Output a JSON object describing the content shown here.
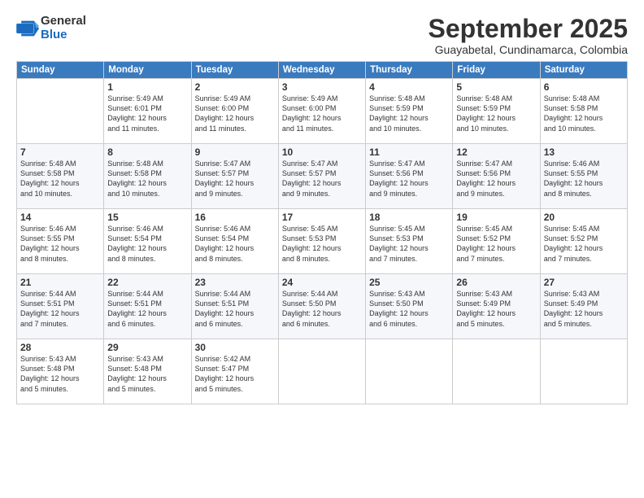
{
  "logo": {
    "general": "General",
    "blue": "Blue"
  },
  "title": "September 2025",
  "location": "Guayabetal, Cundinamarca, Colombia",
  "days_of_week": [
    "Sunday",
    "Monday",
    "Tuesday",
    "Wednesday",
    "Thursday",
    "Friday",
    "Saturday"
  ],
  "weeks": [
    [
      {
        "day": "",
        "info": ""
      },
      {
        "day": "1",
        "info": "Sunrise: 5:49 AM\nSunset: 6:01 PM\nDaylight: 12 hours\nand 11 minutes."
      },
      {
        "day": "2",
        "info": "Sunrise: 5:49 AM\nSunset: 6:00 PM\nDaylight: 12 hours\nand 11 minutes."
      },
      {
        "day": "3",
        "info": "Sunrise: 5:49 AM\nSunset: 6:00 PM\nDaylight: 12 hours\nand 11 minutes."
      },
      {
        "day": "4",
        "info": "Sunrise: 5:48 AM\nSunset: 5:59 PM\nDaylight: 12 hours\nand 10 minutes."
      },
      {
        "day": "5",
        "info": "Sunrise: 5:48 AM\nSunset: 5:59 PM\nDaylight: 12 hours\nand 10 minutes."
      },
      {
        "day": "6",
        "info": "Sunrise: 5:48 AM\nSunset: 5:58 PM\nDaylight: 12 hours\nand 10 minutes."
      }
    ],
    [
      {
        "day": "7",
        "info": "Sunrise: 5:48 AM\nSunset: 5:58 PM\nDaylight: 12 hours\nand 10 minutes."
      },
      {
        "day": "8",
        "info": "Sunrise: 5:48 AM\nSunset: 5:58 PM\nDaylight: 12 hours\nand 10 minutes."
      },
      {
        "day": "9",
        "info": "Sunrise: 5:47 AM\nSunset: 5:57 PM\nDaylight: 12 hours\nand 9 minutes."
      },
      {
        "day": "10",
        "info": "Sunrise: 5:47 AM\nSunset: 5:57 PM\nDaylight: 12 hours\nand 9 minutes."
      },
      {
        "day": "11",
        "info": "Sunrise: 5:47 AM\nSunset: 5:56 PM\nDaylight: 12 hours\nand 9 minutes."
      },
      {
        "day": "12",
        "info": "Sunrise: 5:47 AM\nSunset: 5:56 PM\nDaylight: 12 hours\nand 9 minutes."
      },
      {
        "day": "13",
        "info": "Sunrise: 5:46 AM\nSunset: 5:55 PM\nDaylight: 12 hours\nand 8 minutes."
      }
    ],
    [
      {
        "day": "14",
        "info": "Sunrise: 5:46 AM\nSunset: 5:55 PM\nDaylight: 12 hours\nand 8 minutes."
      },
      {
        "day": "15",
        "info": "Sunrise: 5:46 AM\nSunset: 5:54 PM\nDaylight: 12 hours\nand 8 minutes."
      },
      {
        "day": "16",
        "info": "Sunrise: 5:46 AM\nSunset: 5:54 PM\nDaylight: 12 hours\nand 8 minutes."
      },
      {
        "day": "17",
        "info": "Sunrise: 5:45 AM\nSunset: 5:53 PM\nDaylight: 12 hours\nand 8 minutes."
      },
      {
        "day": "18",
        "info": "Sunrise: 5:45 AM\nSunset: 5:53 PM\nDaylight: 12 hours\nand 7 minutes."
      },
      {
        "day": "19",
        "info": "Sunrise: 5:45 AM\nSunset: 5:52 PM\nDaylight: 12 hours\nand 7 minutes."
      },
      {
        "day": "20",
        "info": "Sunrise: 5:45 AM\nSunset: 5:52 PM\nDaylight: 12 hours\nand 7 minutes."
      }
    ],
    [
      {
        "day": "21",
        "info": "Sunrise: 5:44 AM\nSunset: 5:51 PM\nDaylight: 12 hours\nand 7 minutes."
      },
      {
        "day": "22",
        "info": "Sunrise: 5:44 AM\nSunset: 5:51 PM\nDaylight: 12 hours\nand 6 minutes."
      },
      {
        "day": "23",
        "info": "Sunrise: 5:44 AM\nSunset: 5:51 PM\nDaylight: 12 hours\nand 6 minutes."
      },
      {
        "day": "24",
        "info": "Sunrise: 5:44 AM\nSunset: 5:50 PM\nDaylight: 12 hours\nand 6 minutes."
      },
      {
        "day": "25",
        "info": "Sunrise: 5:43 AM\nSunset: 5:50 PM\nDaylight: 12 hours\nand 6 minutes."
      },
      {
        "day": "26",
        "info": "Sunrise: 5:43 AM\nSunset: 5:49 PM\nDaylight: 12 hours\nand 5 minutes."
      },
      {
        "day": "27",
        "info": "Sunrise: 5:43 AM\nSunset: 5:49 PM\nDaylight: 12 hours\nand 5 minutes."
      }
    ],
    [
      {
        "day": "28",
        "info": "Sunrise: 5:43 AM\nSunset: 5:48 PM\nDaylight: 12 hours\nand 5 minutes."
      },
      {
        "day": "29",
        "info": "Sunrise: 5:43 AM\nSunset: 5:48 PM\nDaylight: 12 hours\nand 5 minutes."
      },
      {
        "day": "30",
        "info": "Sunrise: 5:42 AM\nSunset: 5:47 PM\nDaylight: 12 hours\nand 5 minutes."
      },
      {
        "day": "",
        "info": ""
      },
      {
        "day": "",
        "info": ""
      },
      {
        "day": "",
        "info": ""
      },
      {
        "day": "",
        "info": ""
      }
    ]
  ]
}
